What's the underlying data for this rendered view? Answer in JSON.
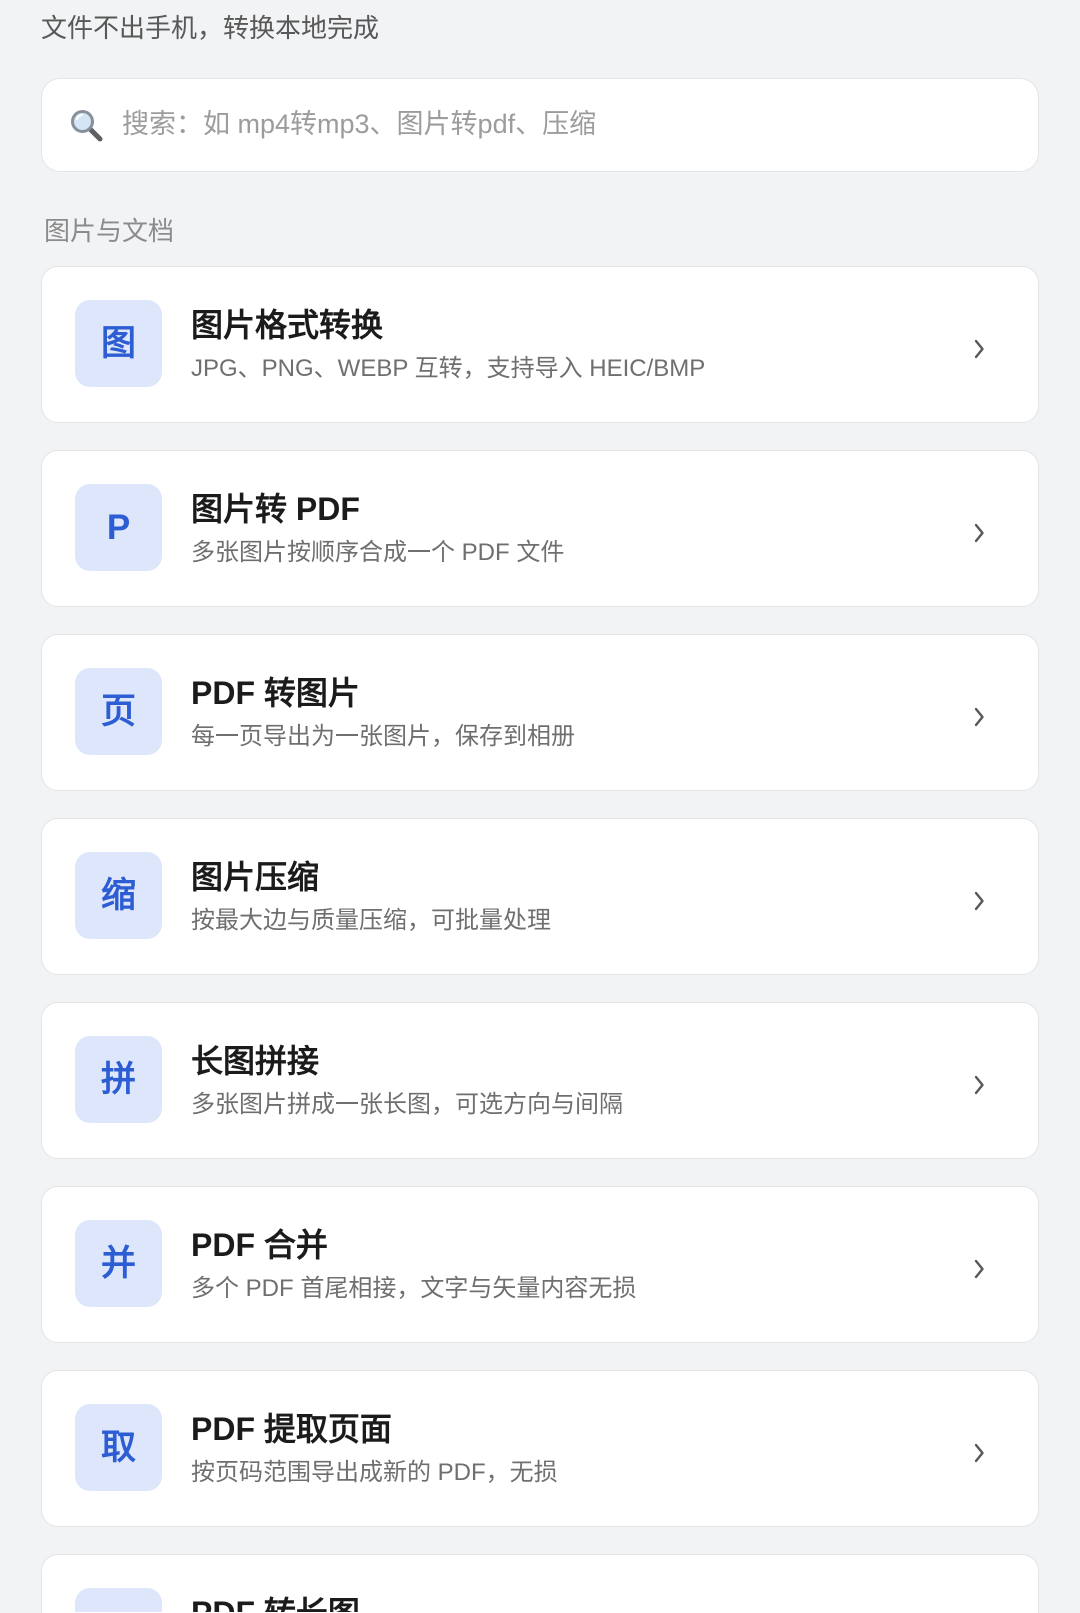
{
  "tagline": "文件不出手机，转换本地完成",
  "search": {
    "icon": "search-icon",
    "placeholder": "搜索：如 mp4转mp3、图片转pdf、压缩"
  },
  "section": {
    "label": "图片与文档",
    "item_trailing_icon": "chevron-right-icon",
    "items": [
      {
        "icon_text": "图",
        "title": "图片格式转换",
        "subtitle": "JPG、PNG、WEBP 互转，支持导入 HEIC/BMP"
      },
      {
        "icon_text": "P",
        "title": "图片转 PDF",
        "subtitle": "多张图片按顺序合成一个 PDF 文件"
      },
      {
        "icon_text": "页",
        "title": "PDF 转图片",
        "subtitle": "每一页导出为一张图片，保存到相册"
      },
      {
        "icon_text": "缩",
        "title": "图片压缩",
        "subtitle": "按最大边与质量压缩，可批量处理"
      },
      {
        "icon_text": "拼",
        "title": "长图拼接",
        "subtitle": "多张图片拼成一张长图，可选方向与间隔"
      },
      {
        "icon_text": "并",
        "title": "PDF 合并",
        "subtitle": "多个 PDF 首尾相接，文字与矢量内容无损"
      },
      {
        "icon_text": "取",
        "title": "PDF 提取页面",
        "subtitle": "按页码范围导出成新的 PDF，无损"
      }
    ],
    "peek_item": {
      "title": "PDF 转长图"
    }
  },
  "colors": {
    "bg": "#f2f3f5",
    "card": "#ffffff",
    "border": "#e2e4e8",
    "accent": "#2c5dd3",
    "accent_soft": "#dee6fb",
    "text": "#1b1b1b",
    "muted": "#6f6f6f",
    "tagline": "#585858",
    "faint": "#8b8b8b",
    "placeholder": "#9c9c9c",
    "chevron": "#585858"
  }
}
